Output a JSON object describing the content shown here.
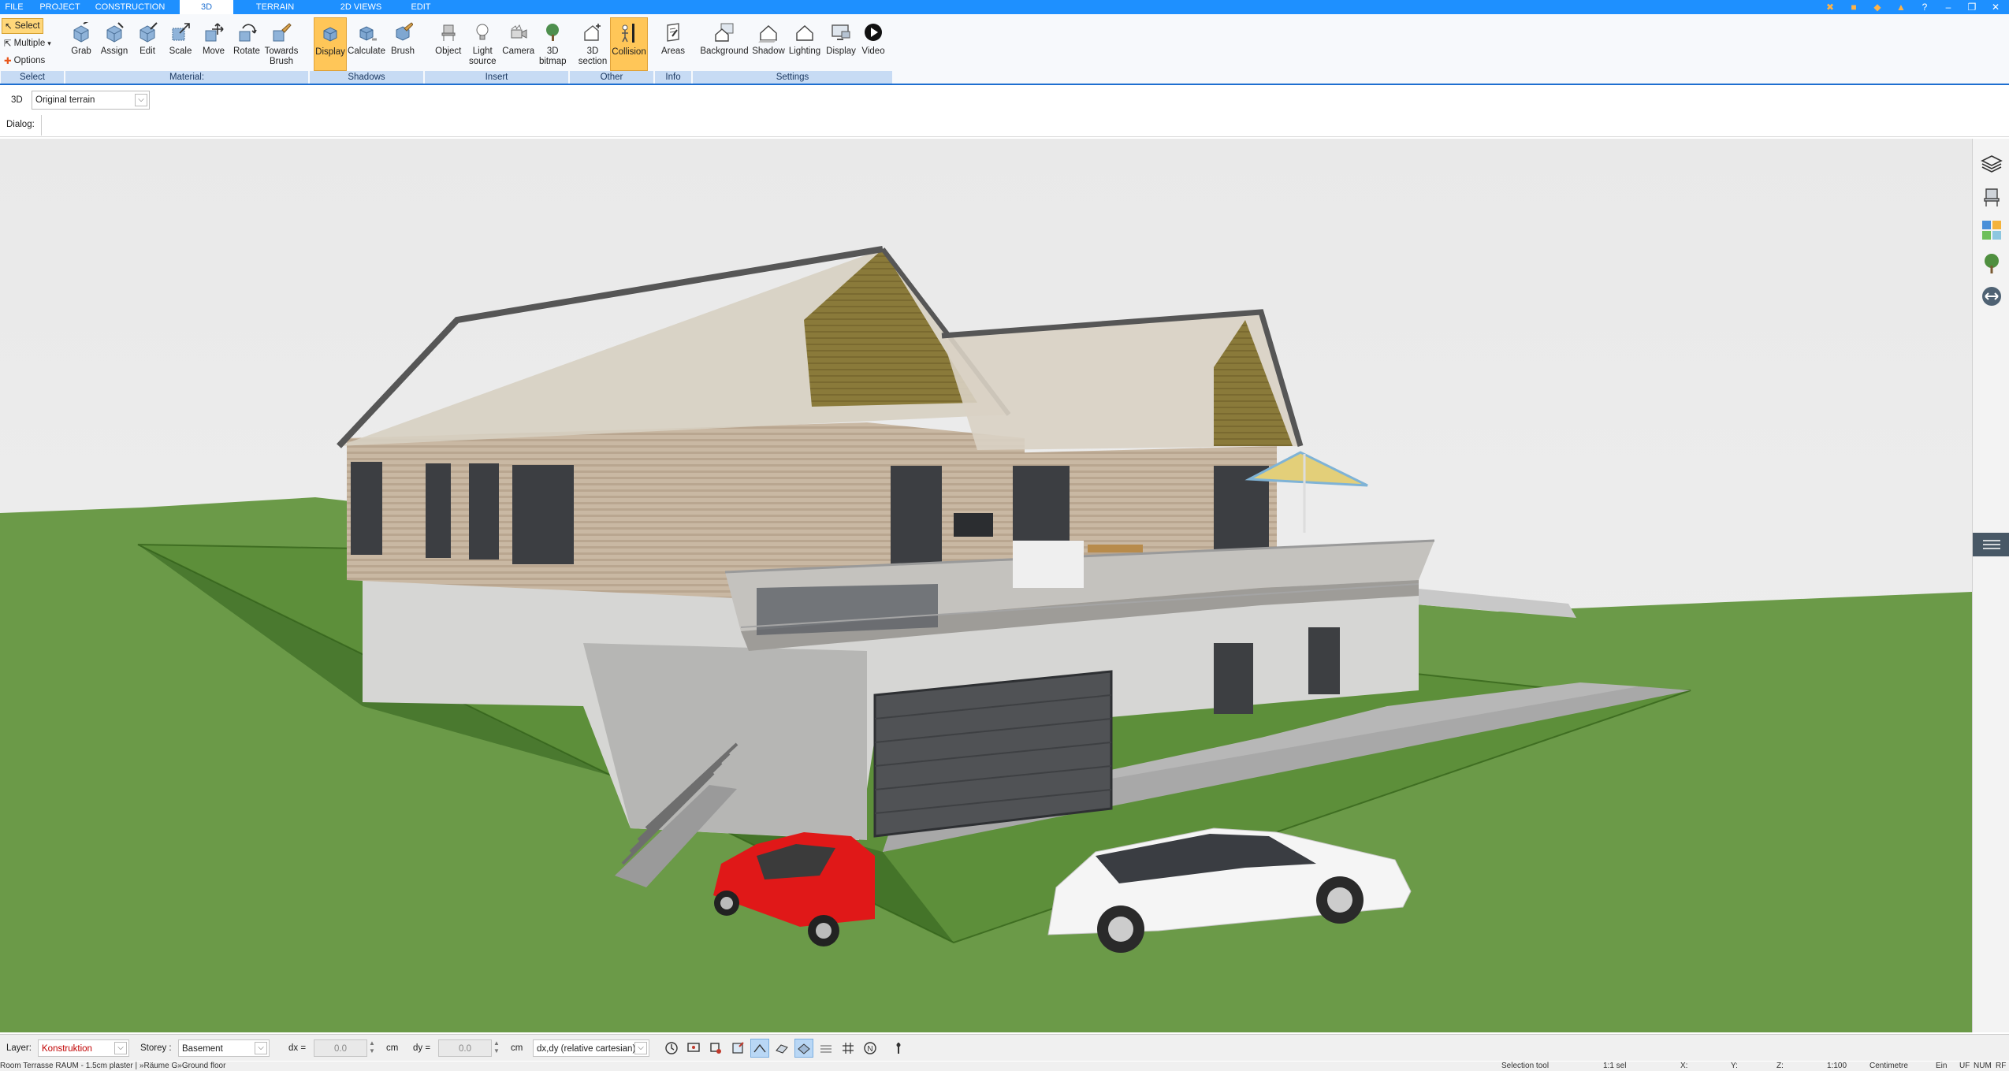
{
  "tabs": [
    {
      "label": "FILE"
    },
    {
      "label": "PROJECT"
    },
    {
      "label": "CONSTRUCTION"
    },
    {
      "label": "3D",
      "active": true
    },
    {
      "label": "TERRAIN"
    },
    {
      "label": "2D VIEWS"
    },
    {
      "label": "EDIT"
    }
  ],
  "window_icons": [
    "tools-icon",
    "box-icon",
    "palette-icon",
    "fill-icon",
    "help-icon",
    "minimize-icon",
    "restore-icon",
    "close-icon"
  ],
  "ribbon": {
    "select_group": {
      "select": "Select",
      "multiple": "Multiple",
      "options": "Options",
      "label": "Select"
    },
    "material_group": {
      "label": "Material:",
      "buttons": [
        {
          "label": "Grab",
          "icon": "cube-grab-icon"
        },
        {
          "label": "Assign",
          "icon": "cube-assign-icon"
        },
        {
          "label": "Edit",
          "icon": "cube-edit-icon"
        },
        {
          "label": "Scale",
          "icon": "scale-icon"
        },
        {
          "label": "Move",
          "icon": "move-icon"
        },
        {
          "label": "Rotate",
          "icon": "rotate-icon"
        },
        {
          "label": "Towards Brush",
          "icon": "towards-brush-icon"
        }
      ]
    },
    "shadows_group": {
      "label": "Shadows",
      "buttons": [
        {
          "label": "Display",
          "icon": "shadow-display-icon",
          "active": true
        },
        {
          "label": "Calculate",
          "icon": "shadow-calculate-icon"
        },
        {
          "label": "Brush",
          "icon": "shadow-brush-icon"
        }
      ]
    },
    "insert_group": {
      "label": "Insert",
      "buttons": [
        {
          "label": "Object",
          "icon": "chair-icon"
        },
        {
          "label": "Light source",
          "icon": "lightbulb-icon"
        },
        {
          "label": "Camera",
          "icon": "camera-icon"
        },
        {
          "label": "3D bitmap",
          "icon": "tree-icon"
        }
      ]
    },
    "other_group": {
      "label": "Other",
      "buttons": [
        {
          "label": "3D section",
          "icon": "section-icon"
        },
        {
          "label": "Collision",
          "icon": "collision-icon",
          "active": true
        }
      ]
    },
    "info_group": {
      "label": "Info",
      "buttons": [
        {
          "label": "Areas",
          "icon": "areas-icon"
        }
      ]
    },
    "settings_group": {
      "label": "Settings",
      "buttons": [
        {
          "label": "Background",
          "icon": "background-icon"
        },
        {
          "label": "Shadow",
          "icon": "house-shadow-icon"
        },
        {
          "label": "Lighting",
          "icon": "house-lighting-icon"
        },
        {
          "label": "Display",
          "icon": "monitor-icon"
        },
        {
          "label": "Video",
          "icon": "play-icon"
        }
      ]
    }
  },
  "viewbar": {
    "view_label": "3D",
    "terrain_value": "Original terrain"
  },
  "dialog_label": "Dialog:",
  "rightbar_icons": [
    "layers-icon",
    "chair-icon",
    "materials-icon",
    "tree-icon",
    "measure-icon",
    "menu-icon"
  ],
  "statusbar": {
    "layer_label": "Layer:",
    "layer_value": "Konstruktion",
    "storey_label": "Storey :",
    "storey_value": "Basement",
    "dx_label": "dx =",
    "dx_value": "0.0",
    "dx_unit": "cm",
    "dy_label": "dy =",
    "dy_value": "0.0",
    "dy_unit": "cm",
    "coord_mode": "dx,dy (relative cartesian)"
  },
  "infoline": {
    "room": "Room Terrasse RAUM - 1.5cm plaster | »Räume G»Ground floor",
    "tool": "Selection tool",
    "sel": "1:1 sel",
    "x": "X:",
    "y": "Y:",
    "z": "Z:",
    "scale": "1:100",
    "unit": "Centimetre",
    "lang": "Ein",
    "uf": "UF",
    "num": "NUM",
    "rf": "RF"
  }
}
